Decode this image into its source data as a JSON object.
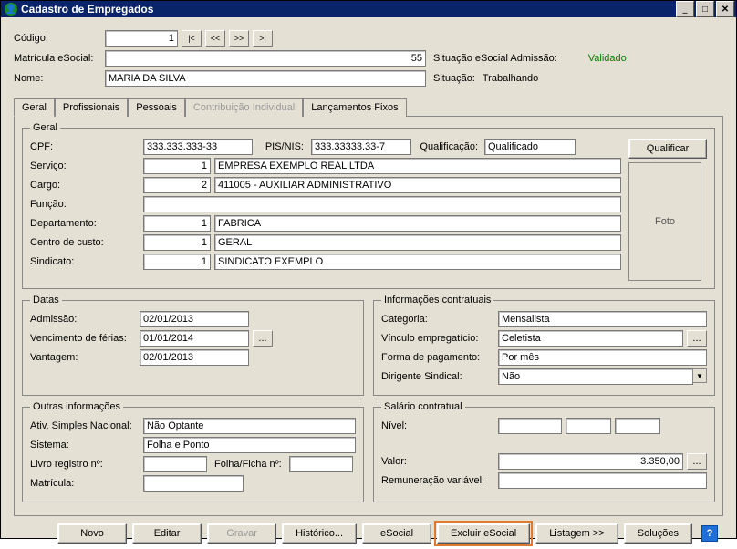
{
  "window": {
    "title": "Cadastro de Empregados"
  },
  "header": {
    "codigo_label": "Código:",
    "codigo_value": "1",
    "matricula_label": "Matrícula eSocial:",
    "matricula_value": "55",
    "nome_label": "Nome:",
    "nome_value": "MARIA DA SILVA",
    "sit_esocial_label": "Situação eSocial Admissão:",
    "sit_esocial_status": "Validado",
    "sit_label": "Situação:",
    "sit_value": "Trabalhando"
  },
  "tabs": {
    "t0": "Geral",
    "t1": "Profissionais",
    "t2": "Pessoais",
    "t3": "Contribuição Individual",
    "t4": "Lançamentos Fixos"
  },
  "geral": {
    "legend": "Geral",
    "cpf_label": "CPF:",
    "cpf_value": "333.333.333-33",
    "pis_label": "PIS/NIS:",
    "pis_value": "333.33333.33-7",
    "qual_label": "Qualificação:",
    "qual_value": "Qualificado",
    "qual_button": "Qualificar",
    "servico_label": "Serviço:",
    "servico_code": "1",
    "servico_value": "EMPRESA EXEMPLO REAL LTDA",
    "cargo_label": "Cargo:",
    "cargo_code": "2",
    "cargo_value": "411005 - AUXILIAR ADMINISTRATIVO",
    "funcao_label": "Função:",
    "funcao_value": "",
    "depto_label": "Departamento:",
    "depto_code": "1",
    "depto_value": "FABRICA",
    "centro_label": "Centro de custo:",
    "centro_code": "1",
    "centro_value": "GERAL",
    "sind_label": "Sindicato:",
    "sind_code": "1",
    "sind_value": "SINDICATO EXEMPLO",
    "foto_label": "Foto"
  },
  "datas": {
    "legend": "Datas",
    "admissao_label": "Admissão:",
    "admissao_value": "02/01/2013",
    "venc_label": "Vencimento de férias:",
    "venc_value": "01/01/2014",
    "vant_label": "Vantagem:",
    "vant_value": "02/01/2013",
    "btn_ell": "..."
  },
  "info": {
    "legend": "Informações contratuais",
    "cat_label": "Categoria:",
    "cat_value": "Mensalista",
    "vinc_label": "Vínculo empregatício:",
    "vinc_value": "Celetista",
    "forma_label": "Forma de pagamento:",
    "forma_value": "Por mês",
    "dir_label": "Dirigente Sindical:",
    "dir_value": "Não",
    "btn_ell": "..."
  },
  "outras": {
    "legend": "Outras informações",
    "ativ_label": "Ativ. Simples Nacional:",
    "ativ_value": "Não Optante",
    "sist_label": "Sistema:",
    "sist_value": "Folha e Ponto",
    "livro_label": "Livro registro nº:",
    "livro_value": "",
    "folha_label": "Folha/Ficha nº:",
    "folha_value": "",
    "mat_label": "Matrícula:",
    "mat_value": ""
  },
  "salario": {
    "legend": "Salário contratual",
    "nivel_label": "Nível:",
    "valor_label": "Valor:",
    "valor_value": "3.350,00",
    "remun_label": "Remuneração variável:",
    "btn_ell": "..."
  },
  "bottom": {
    "novo": "Novo",
    "editar": "Editar",
    "gravar": "Gravar",
    "historico": "Histórico...",
    "esocial": "eSocial",
    "excluir": "Excluir eSocial",
    "listagem": "Listagem >>",
    "solucoes": "Soluções"
  }
}
